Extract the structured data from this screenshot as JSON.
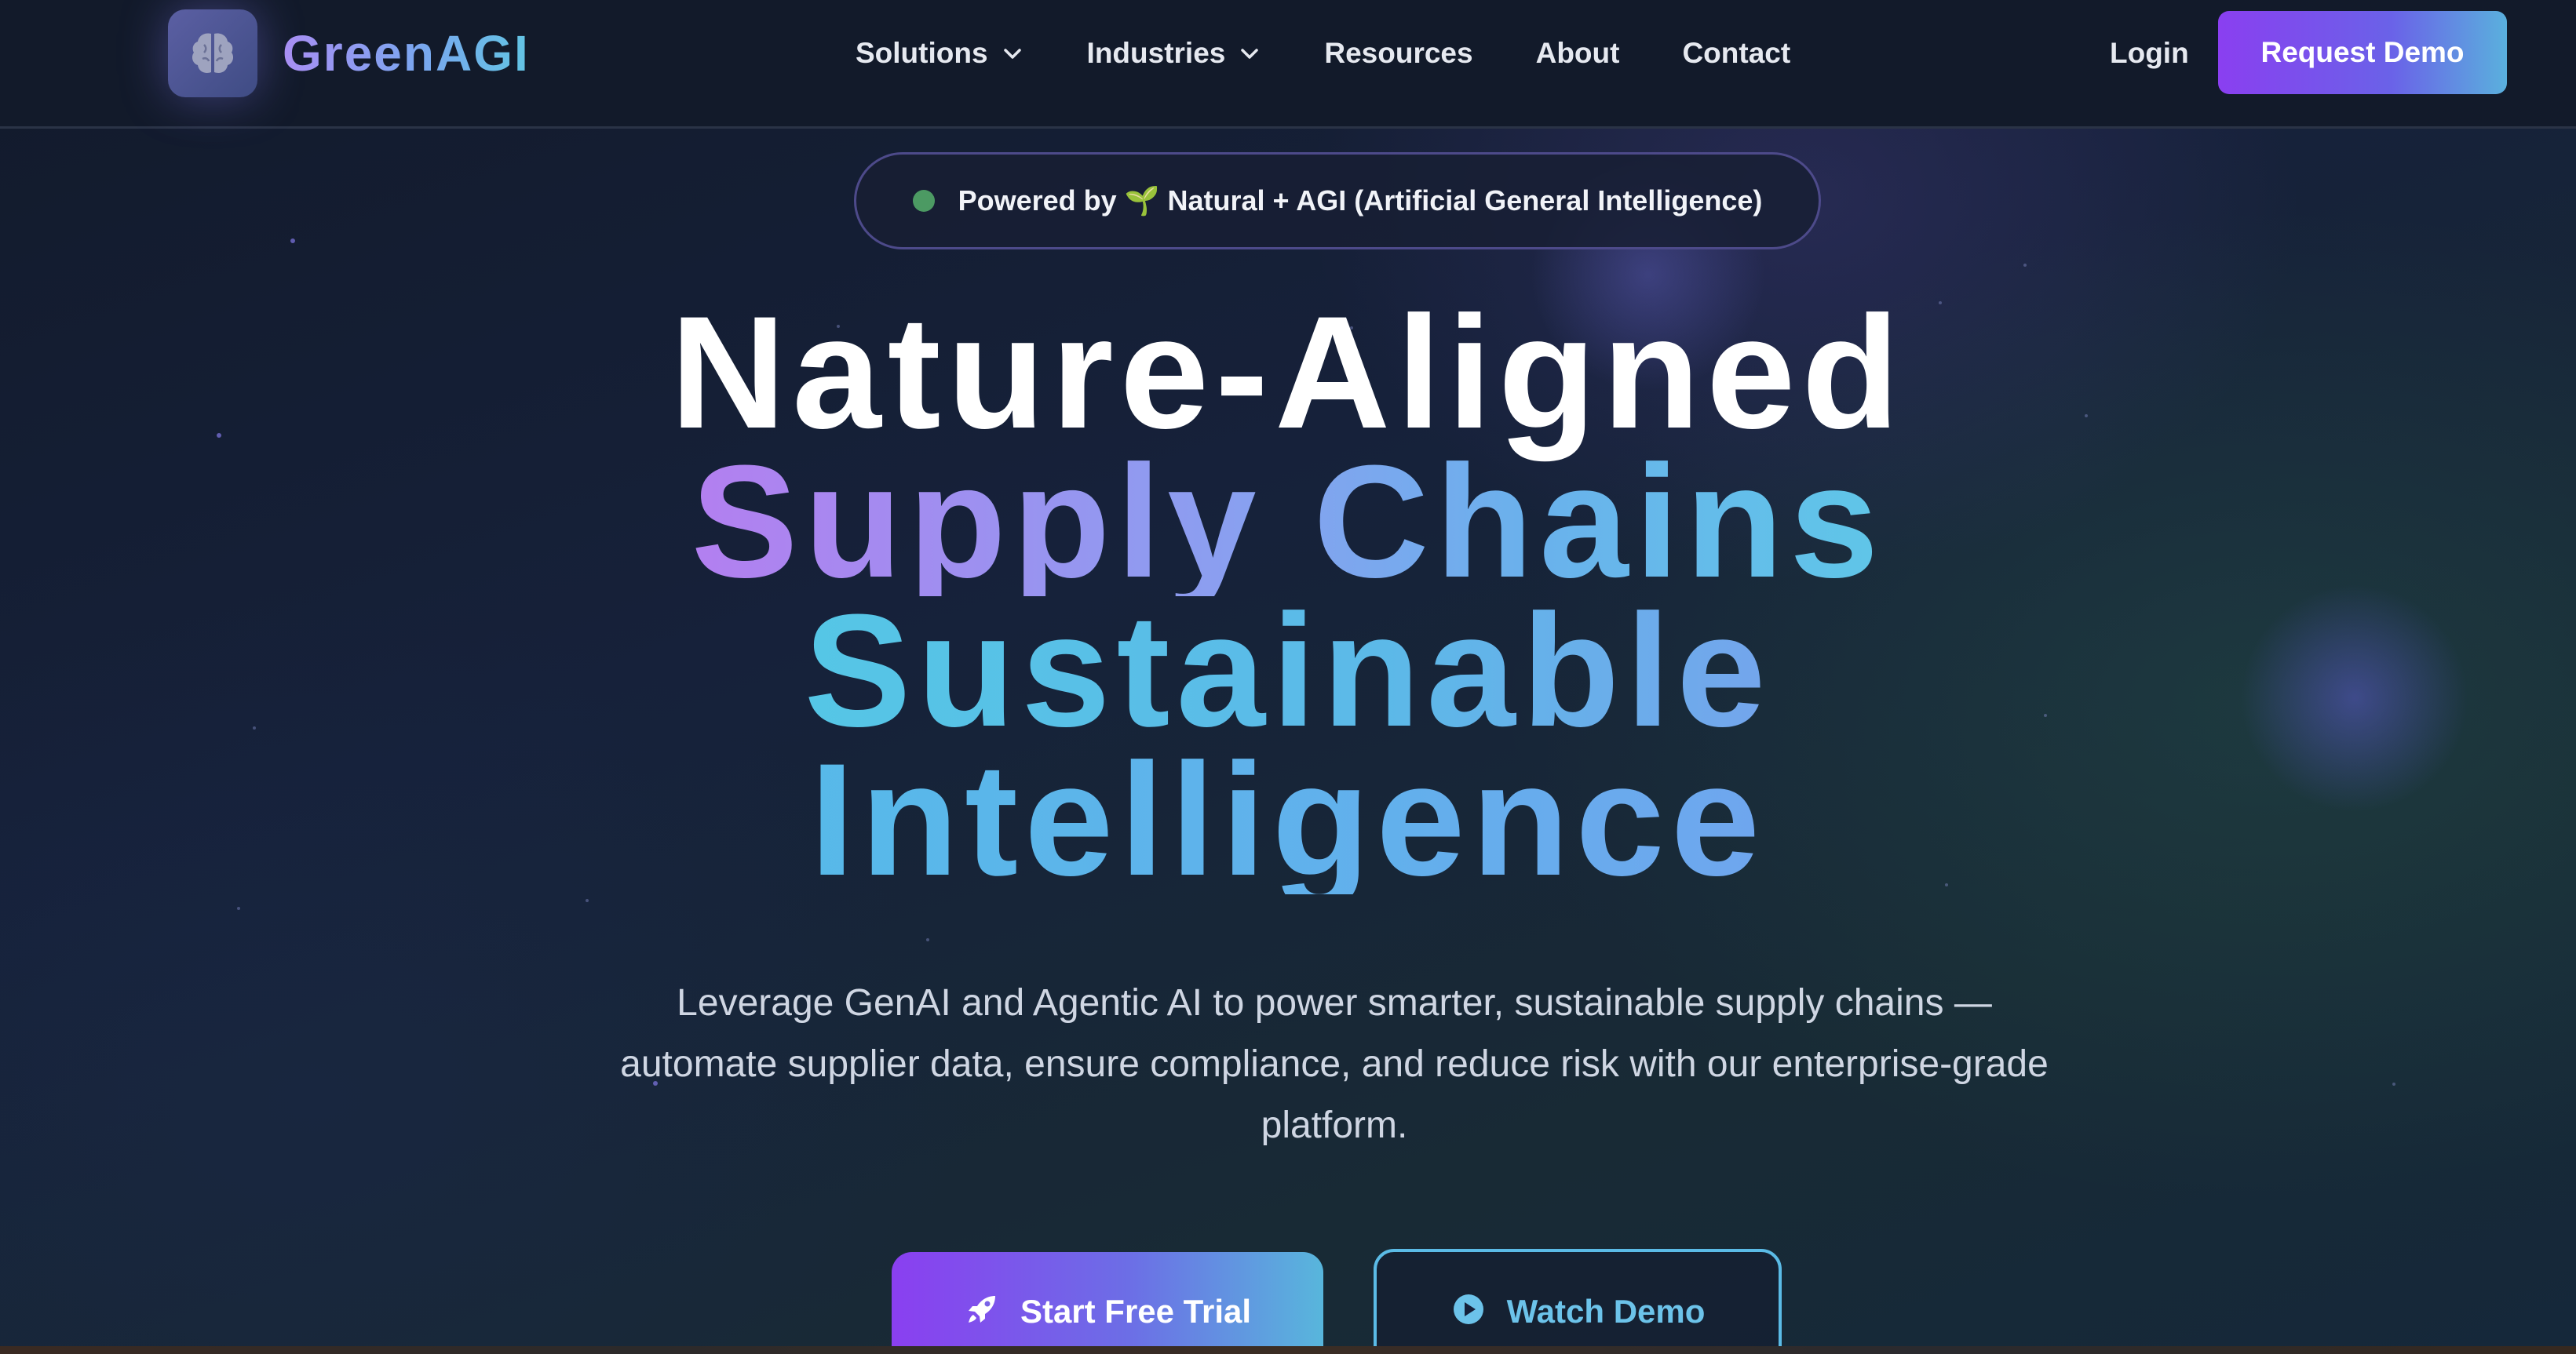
{
  "header": {
    "brand": "GreenAGI",
    "logo_icon": "brain-icon",
    "nav": [
      {
        "label": "Solutions",
        "has_dropdown": true
      },
      {
        "label": "Industries",
        "has_dropdown": true
      },
      {
        "label": "Resources",
        "has_dropdown": false
      },
      {
        "label": "About",
        "has_dropdown": false
      },
      {
        "label": "Contact",
        "has_dropdown": false
      }
    ],
    "login": "Login",
    "request_demo": "Request Demo"
  },
  "badge": {
    "text": "Powered by 🌱 Natural + AGI (Artificial General Intelligence)",
    "dot_color": "#4c9a63"
  },
  "hero": {
    "line1": "Nature-Aligned",
    "line2": "Supply Chains",
    "line3": "Sustainable",
    "line4": "Intelligence",
    "subtitle": "Leverage GenAI and Agentic AI to power smarter, sustainable supply chains — automate supplier data, ensure compliance, and reduce risk with our enterprise-grade platform."
  },
  "cta": {
    "primary": {
      "label": "Start Free Trial",
      "icon": "rocket-icon"
    },
    "secondary": {
      "label": "Watch Demo",
      "icon": "play-circle-icon"
    }
  },
  "colors": {
    "accent_purple": "#8a3ff0",
    "accent_cyan": "#5ab0dd",
    "background": "#131b2c"
  }
}
